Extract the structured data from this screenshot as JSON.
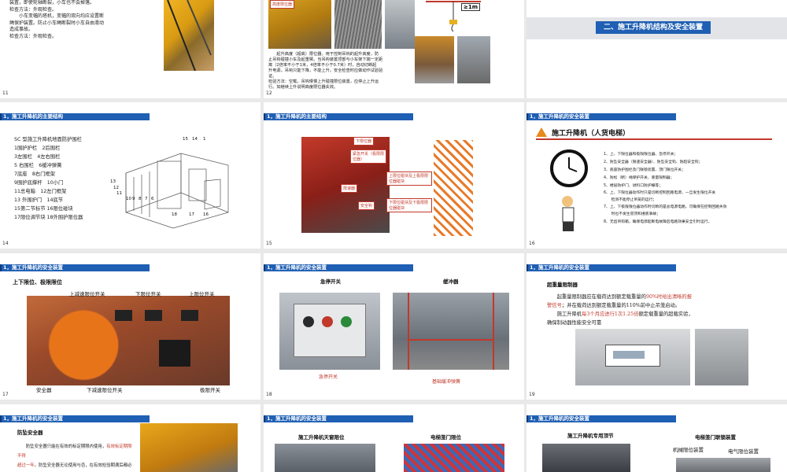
{
  "slides": {
    "s11": {
      "num": "11",
      "lines": [
        "装置，即使轮轴断裂，小车也不会掉落。",
        "检查方法：外观检查。",
        "　　小车变幅的塔机，变幅的双向均应设置断",
        "绳保护装置。防止小车绳断裂时小车自由滑动",
        "造成事故。",
        "检查方法：外观检查。"
      ]
    },
    "s12": {
      "num": "12",
      "tag": "高度限位器",
      "dist": "≥1m",
      "lines": [
        "　　起升高度（超高）限位器，用于控制吊钩的起升高度，防",
        "止吊钩碰撞小车及起重臂。当吊钩装置顶部与小车架下端一定距",
        "离（2倍率不小于1米，4倍率不小于0.7米）时，自动切断起",
        "升电源，吊钩只能下降，不能上升。安全检查时应做动作试验验",
        "证。",
        "检验方法：空载，吊钩慢慢上升碰撞限位装置，应停止上升运",
        "行。如继续上升说明高度限位器失效。"
      ]
    },
    "s13": {
      "num": "",
      "title": "二、施工升降机结构及安全装置"
    },
    "s14": {
      "num": "14",
      "header": "1，施工升降机的主要结构",
      "lines": [
        "SC 型施工升降机地面防护围栏",
        "1围护护栏　2后围栏",
        "3左围栏　4左右围栏",
        "5 右围栏　6缓冲弹簧",
        "7底座　8右门框架",
        "9围护底撑杆　10小门",
        "11总电箱　12左门框架",
        "13 外围护门　14底节",
        "15第二节标节 16限位碰块",
        "17限位调节块 18外围护限位器"
      ],
      "diagram_nums": [
        "15",
        "14",
        "1",
        "13",
        "12",
        "11",
        "10",
        "9",
        "8",
        "7",
        "6",
        "18",
        "17",
        "16"
      ]
    },
    "s15": {
      "num": "15",
      "header": "1，施工升降机的主要结构",
      "callouts": [
        "下限位器",
        "紧急开关（极限限位器）",
        "上限位碰块及上极限限位器碰块",
        "限速器",
        "安全钩",
        "下限位碰块及下极限限位器碰块"
      ]
    },
    "s16": {
      "num": "16",
      "header": "1，施工升降机的安全装置",
      "title": "施工升降机（人货电梯）",
      "items": [
        "1、上、下限位器和极限限位器、急停开关；",
        "2、防坠安全器（限速安全器）、防坠安全钩、防超安全钩；",
        "3、底座防护围栏及门联锁装置、顶门限位开关；",
        "4、防松（断）绳保护开关、重量限制器；",
        "5、楼层防护门、进料口防护栅等；",
        "6、上、下限位器动作时只是切断控制回路电源，一旦发生限位开关",
        "　　检测不能停止吊笼的运行；",
        "7、上、下极限限位器动作时切断的是总电源电路，可确保在控制回路失效",
        "　　时也不发生冒顶和撞底事故；",
        "8、无齿吊钩箱，确保电源起断电故障后电路效果安全引时运行。"
      ]
    },
    "s17": {
      "num": "17",
      "header": "1，施工升降机的安全装置",
      "title": "上下限位、极限限位",
      "labels": [
        "上减速限位开关",
        "下限位开关",
        "上限位开关",
        "安全器",
        "下减速限位开关",
        "极限开关"
      ]
    },
    "s18": {
      "num": "18",
      "header": "1，施工升降机的安全装置",
      "left_title": "急停开关",
      "right_title": "缓冲器",
      "left_cap": "急停开关",
      "right_cap": "基础缓冲弹簧"
    },
    "s19": {
      "num": "19",
      "header": "1，施工升降机的安全装置",
      "title": "超重量限制器",
      "line1_a": "　　起重量限制器应在载荷达到额定载重量的",
      "line1_b": "90%时给出清晰的报",
      "line2_a": "警信号",
      "line2_b": "；并在载荷达到额定载重量的110%前中止吊笼启动。",
      "line3_a": "　　施工升降机",
      "line3_b": "每3个月应进行1次1.25倍",
      "line3_c": "额定载重量的超载实验，",
      "line4": "确保制动器性能安全可靠"
    },
    "s20": {
      "num": "",
      "header": "1，施工升降机的安全装置",
      "title": "防坠安全器",
      "line1_a": "　　防坠安全器只能在有效的标定期限内使用，",
      "line1_b": "有效标定期限不得",
      "line2_a": "超过一年",
      "line2_b": "。防坠安全器无论使用与否，在有效检验期满后都必须重"
    },
    "s21": {
      "num": "",
      "header": "1，施工升降机的安全装置",
      "left_title": "施工升降机天窗限位",
      "right_title": "电梯笼门限位"
    },
    "s22": {
      "num": "",
      "header": "1，施工升降机的安全装置",
      "left_title": "施工升降机专用顶节",
      "right_title": "电梯笼门联锁装置",
      "label_a": "机械限位装置",
      "label_b": "电气限位装置"
    }
  },
  "colors": {
    "accent": "#1f5fb4",
    "highlight": "#c0392b",
    "background": "#e9e9ea"
  }
}
